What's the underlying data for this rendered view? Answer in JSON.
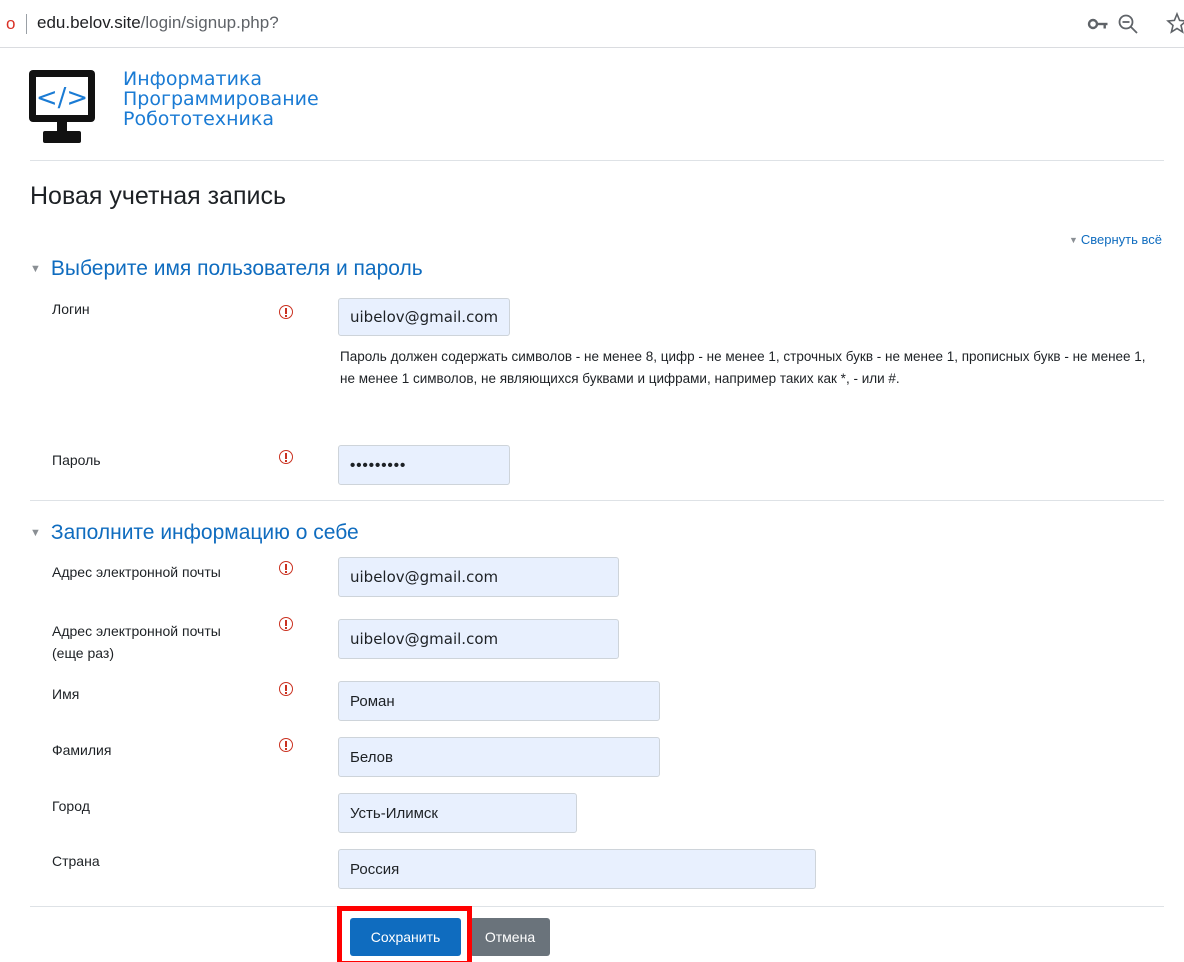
{
  "browser": {
    "url_host": "edu.belov.site",
    "url_path": "/login/signup.php?",
    "security_icon": "o",
    "icons": [
      "key-icon",
      "zoom-icon",
      "star-icon"
    ]
  },
  "logo": {
    "icon": "monitor-code-icon",
    "symbol": "</>",
    "line1": "Информатика",
    "line2": "Программирование",
    "line3": "Робототехника"
  },
  "page": {
    "title": "Новая учетная запись",
    "collapse_all": "Свернуть всё"
  },
  "sections": {
    "account": {
      "heading": "Выберите имя пользователя и пароль",
      "login_label": "Логин",
      "login_value": "uibelov@gmail.com",
      "password_help": "Пароль должен содержать символов - не менее 8, цифр - не менее 1, строчных букв - не менее 1, прописных букв - не менее 1, не менее 1 символов, не являющихся буквами и цифрами, например таких как *, - или #.",
      "password_label": "Пароль",
      "password_value": "•••••••••"
    },
    "profile": {
      "heading": "Заполните информацию о себе",
      "email_label": "Адрес электронной почты",
      "email_value": "uibelov@gmail.com",
      "email2_label_line1": "Адрес электронной почты",
      "email2_label_line2": "(еще раз)",
      "email2_value": "uibelov@gmail.com",
      "firstname_label": "Имя",
      "firstname_value": "Роман",
      "lastname_label": "Фамилия",
      "lastname_value": "Белов",
      "city_label": "Город",
      "city_value": "Усть-Илимск",
      "country_label": "Страна",
      "country_value": "Россия"
    }
  },
  "buttons": {
    "save": "Сохранить",
    "cancel": "Отмена"
  },
  "colors": {
    "accent": "#0f6cbf",
    "required": "#ca3120",
    "field_bg": "#e8f0fe",
    "highlight": "#ff0000",
    "cancel": "#6a737b"
  }
}
